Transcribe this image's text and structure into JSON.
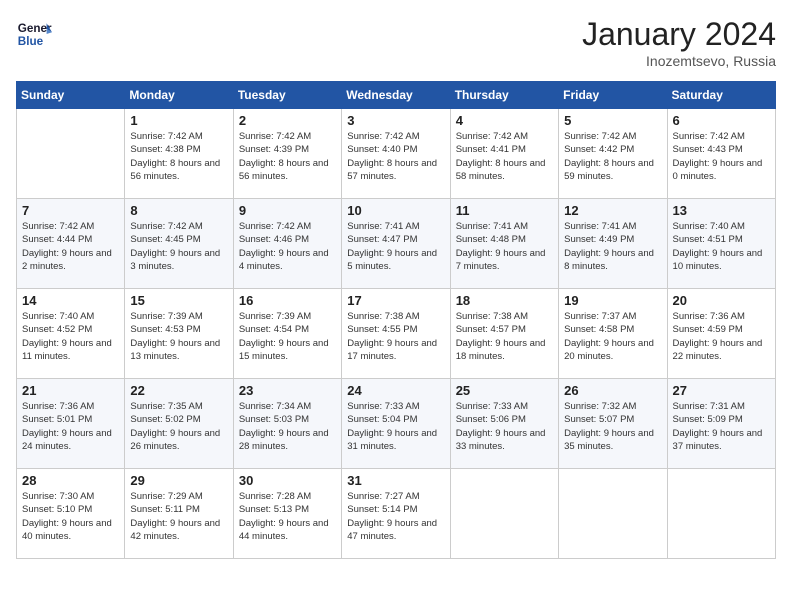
{
  "header": {
    "logo_line1": "General",
    "logo_line2": "Blue",
    "month": "January 2024",
    "location": "Inozemtsevo, Russia"
  },
  "weekdays": [
    "Sunday",
    "Monday",
    "Tuesday",
    "Wednesday",
    "Thursday",
    "Friday",
    "Saturday"
  ],
  "weeks": [
    [
      {
        "day": null
      },
      {
        "day": "1",
        "sunrise": "7:42 AM",
        "sunset": "4:38 PM",
        "daylight": "8 hours and 56 minutes."
      },
      {
        "day": "2",
        "sunrise": "7:42 AM",
        "sunset": "4:39 PM",
        "daylight": "8 hours and 56 minutes."
      },
      {
        "day": "3",
        "sunrise": "7:42 AM",
        "sunset": "4:40 PM",
        "daylight": "8 hours and 57 minutes."
      },
      {
        "day": "4",
        "sunrise": "7:42 AM",
        "sunset": "4:41 PM",
        "daylight": "8 hours and 58 minutes."
      },
      {
        "day": "5",
        "sunrise": "7:42 AM",
        "sunset": "4:42 PM",
        "daylight": "8 hours and 59 minutes."
      },
      {
        "day": "6",
        "sunrise": "7:42 AM",
        "sunset": "4:43 PM",
        "daylight": "9 hours and 0 minutes."
      }
    ],
    [
      {
        "day": "7",
        "sunrise": "7:42 AM",
        "sunset": "4:44 PM",
        "daylight": "9 hours and 2 minutes."
      },
      {
        "day": "8",
        "sunrise": "7:42 AM",
        "sunset": "4:45 PM",
        "daylight": "9 hours and 3 minutes."
      },
      {
        "day": "9",
        "sunrise": "7:42 AM",
        "sunset": "4:46 PM",
        "daylight": "9 hours and 4 minutes."
      },
      {
        "day": "10",
        "sunrise": "7:41 AM",
        "sunset": "4:47 PM",
        "daylight": "9 hours and 5 minutes."
      },
      {
        "day": "11",
        "sunrise": "7:41 AM",
        "sunset": "4:48 PM",
        "daylight": "9 hours and 7 minutes."
      },
      {
        "day": "12",
        "sunrise": "7:41 AM",
        "sunset": "4:49 PM",
        "daylight": "9 hours and 8 minutes."
      },
      {
        "day": "13",
        "sunrise": "7:40 AM",
        "sunset": "4:51 PM",
        "daylight": "9 hours and 10 minutes."
      }
    ],
    [
      {
        "day": "14",
        "sunrise": "7:40 AM",
        "sunset": "4:52 PM",
        "daylight": "9 hours and 11 minutes."
      },
      {
        "day": "15",
        "sunrise": "7:39 AM",
        "sunset": "4:53 PM",
        "daylight": "9 hours and 13 minutes."
      },
      {
        "day": "16",
        "sunrise": "7:39 AM",
        "sunset": "4:54 PM",
        "daylight": "9 hours and 15 minutes."
      },
      {
        "day": "17",
        "sunrise": "7:38 AM",
        "sunset": "4:55 PM",
        "daylight": "9 hours and 17 minutes."
      },
      {
        "day": "18",
        "sunrise": "7:38 AM",
        "sunset": "4:57 PM",
        "daylight": "9 hours and 18 minutes."
      },
      {
        "day": "19",
        "sunrise": "7:37 AM",
        "sunset": "4:58 PM",
        "daylight": "9 hours and 20 minutes."
      },
      {
        "day": "20",
        "sunrise": "7:36 AM",
        "sunset": "4:59 PM",
        "daylight": "9 hours and 22 minutes."
      }
    ],
    [
      {
        "day": "21",
        "sunrise": "7:36 AM",
        "sunset": "5:01 PM",
        "daylight": "9 hours and 24 minutes."
      },
      {
        "day": "22",
        "sunrise": "7:35 AM",
        "sunset": "5:02 PM",
        "daylight": "9 hours and 26 minutes."
      },
      {
        "day": "23",
        "sunrise": "7:34 AM",
        "sunset": "5:03 PM",
        "daylight": "9 hours and 28 minutes."
      },
      {
        "day": "24",
        "sunrise": "7:33 AM",
        "sunset": "5:04 PM",
        "daylight": "9 hours and 31 minutes."
      },
      {
        "day": "25",
        "sunrise": "7:33 AM",
        "sunset": "5:06 PM",
        "daylight": "9 hours and 33 minutes."
      },
      {
        "day": "26",
        "sunrise": "7:32 AM",
        "sunset": "5:07 PM",
        "daylight": "9 hours and 35 minutes."
      },
      {
        "day": "27",
        "sunrise": "7:31 AM",
        "sunset": "5:09 PM",
        "daylight": "9 hours and 37 minutes."
      }
    ],
    [
      {
        "day": "28",
        "sunrise": "7:30 AM",
        "sunset": "5:10 PM",
        "daylight": "9 hours and 40 minutes."
      },
      {
        "day": "29",
        "sunrise": "7:29 AM",
        "sunset": "5:11 PM",
        "daylight": "9 hours and 42 minutes."
      },
      {
        "day": "30",
        "sunrise": "7:28 AM",
        "sunset": "5:13 PM",
        "daylight": "9 hours and 44 minutes."
      },
      {
        "day": "31",
        "sunrise": "7:27 AM",
        "sunset": "5:14 PM",
        "daylight": "9 hours and 47 minutes."
      },
      {
        "day": null
      },
      {
        "day": null
      },
      {
        "day": null
      }
    ]
  ],
  "labels": {
    "sunrise": "Sunrise:",
    "sunset": "Sunset:",
    "daylight": "Daylight hours"
  }
}
